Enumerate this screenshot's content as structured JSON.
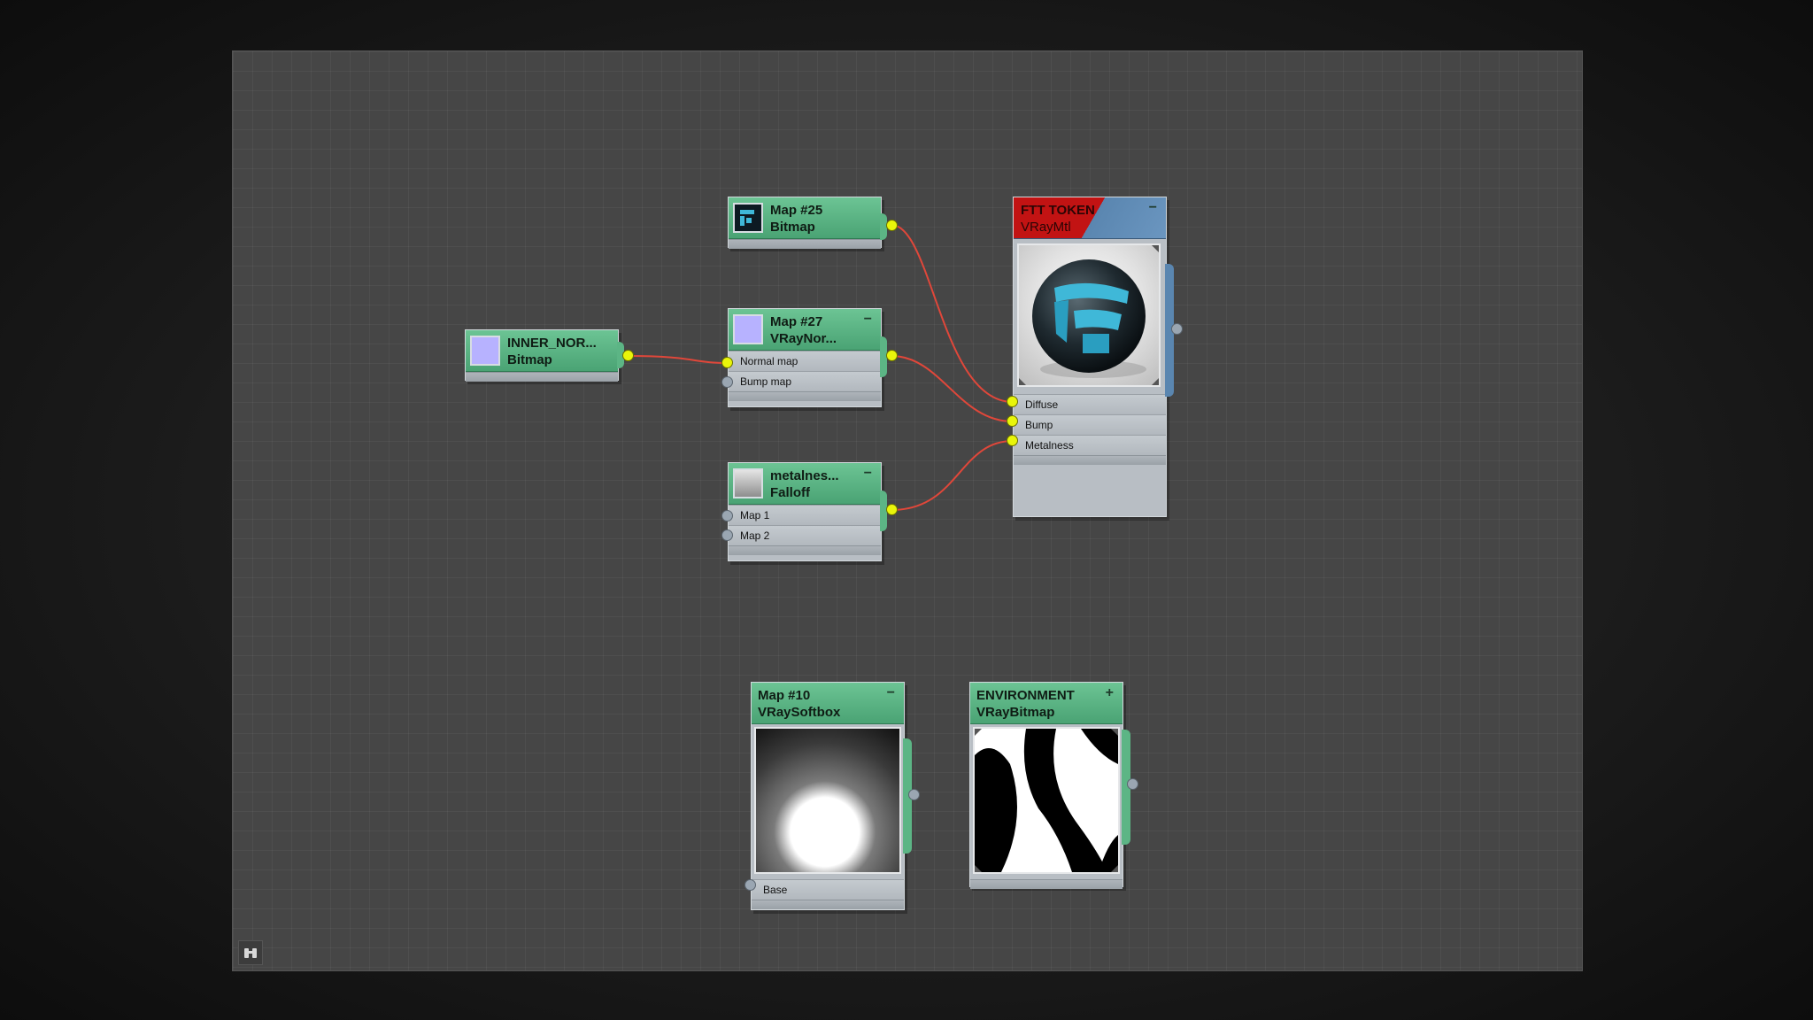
{
  "nodes": {
    "map25": {
      "name": "Map #25",
      "type": "Bitmap"
    },
    "map27": {
      "name": "Map #27",
      "type": "VRayNor...",
      "slots": [
        "Normal map",
        "Bump map"
      ]
    },
    "inner_nor": {
      "name": "INNER_NOR...",
      "type": "Bitmap"
    },
    "metalness": {
      "name": "metalnes...",
      "type": "Falloff",
      "slots": [
        "Map 1",
        "Map 2"
      ]
    },
    "material": {
      "name": "FTT TOKEN",
      "type": "VRayMtl",
      "slots": [
        "Diffuse",
        "Bump",
        "Metalness"
      ]
    },
    "map10": {
      "name": "Map #10",
      "type": "VRaySoftbox",
      "slots": [
        "Base"
      ]
    },
    "environment": {
      "name": "ENVIRONMENT",
      "type": "VRayBitmap"
    }
  },
  "connections": [
    {
      "from": "Map #25",
      "to": "Diffuse"
    },
    {
      "from": "INNER_NOR...",
      "to": "Normal map"
    },
    {
      "from": "Map #27",
      "to": "Bump"
    },
    {
      "from": "metalnes...",
      "to": "Metalness"
    }
  ],
  "colors": {
    "canvas": "#464646",
    "node_header": "#5cb585",
    "material_header_red": "#c21313",
    "material_header_blue": "#5a86b0",
    "connected_socket": "#e9f50a",
    "wire": "#e0473a"
  },
  "icons": {
    "collapse": "minus-icon",
    "expand": "plus-icon",
    "navigator": "binoculars-icon"
  }
}
